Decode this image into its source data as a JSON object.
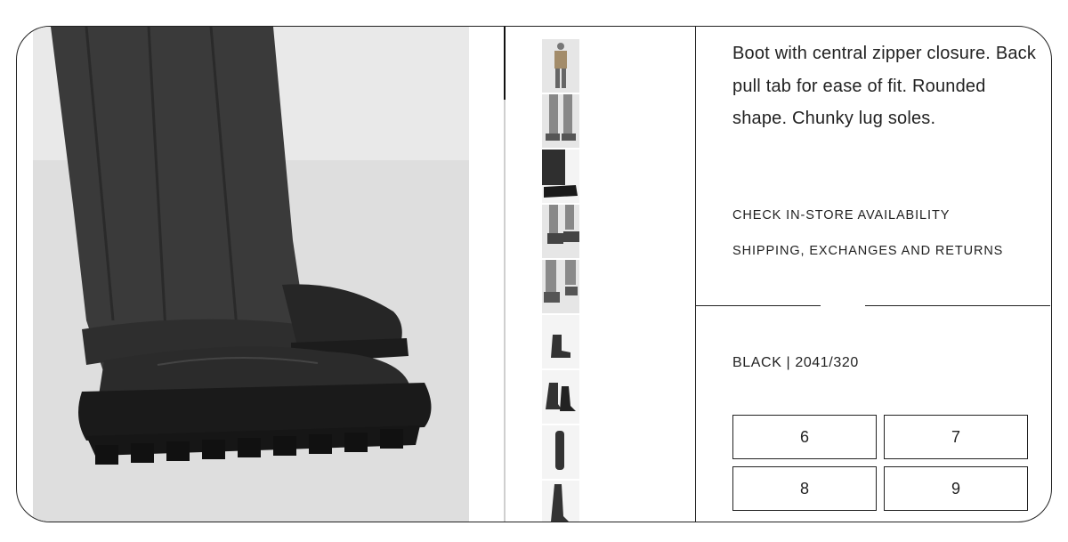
{
  "product": {
    "description": "Boot with central zipper closure. Back pull tab for ease of fit. Rounded shape. Chunky lug soles.",
    "links": {
      "availability": "CHECK IN-STORE AVAILABILITY",
      "shipping": "SHIPPING, EXCHANGES AND RETURNS"
    },
    "color_ref": "BLACK | 2041/320",
    "sizes": [
      "6",
      "7",
      "8",
      "9"
    ]
  },
  "gallery": {
    "thumbnails": [
      "model-full-icon",
      "legs-boots-icon",
      "boots-side-icon",
      "boots-front-icon",
      "boots-walk-icon",
      "boot-single-icon",
      "boots-pair-icon",
      "boot-back-icon",
      "boot-side-icon"
    ]
  },
  "colors": {
    "border": "#222222",
    "photo_bg": "#e9e9e9"
  }
}
